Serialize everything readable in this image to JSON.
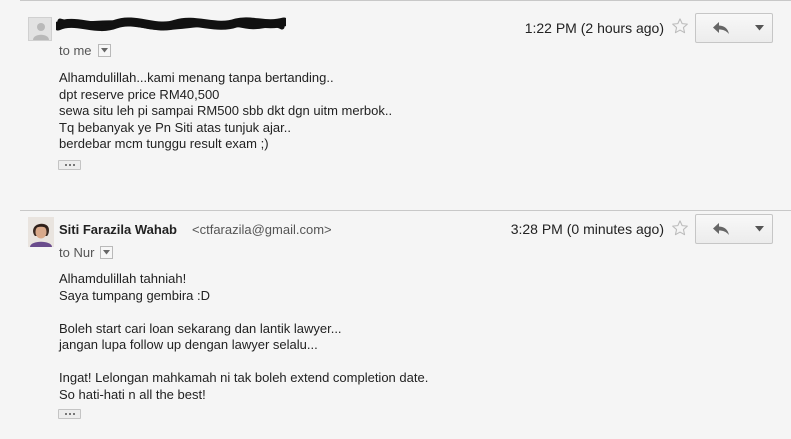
{
  "messages": [
    {
      "sender_redacted": true,
      "time": "1:22 PM (2 hours ago)",
      "to_label": "to me",
      "body_lines": [
        "Alhamdulillah...kami menang tanpa bertanding..",
        "dpt reserve price RM40,500",
        "sewa situ leh pi sampai RM500 sbb dkt dgn uitm merbok..",
        "Tq bebanyak ye Pn Siti atas tunjuk ajar..",
        "berdebar mcm tunggu result exam ;)"
      ]
    },
    {
      "sender_name": "Siti Farazila Wahab",
      "sender_email": "<ctfarazila@gmail.com>",
      "time": "3:28 PM (0 minutes ago)",
      "to_label": "to Nur",
      "body_lines": [
        "Alhamdulillah tahniah!",
        "Saya tumpang gembira :D",
        "",
        "Boleh start cari loan sekarang dan lantik lawyer...",
        "jangan lupa follow up dengan lawyer selalu...",
        "",
        "Ingat! Lelongan mahkamah ni tak boleh extend completion date.",
        "So hati-hati n all the best!"
      ]
    }
  ],
  "icons": {
    "star": "star-outline-icon",
    "reply": "reply-arrow-icon",
    "more": "caret-down-icon",
    "avatar_generic": "person-silhouette-icon"
  }
}
